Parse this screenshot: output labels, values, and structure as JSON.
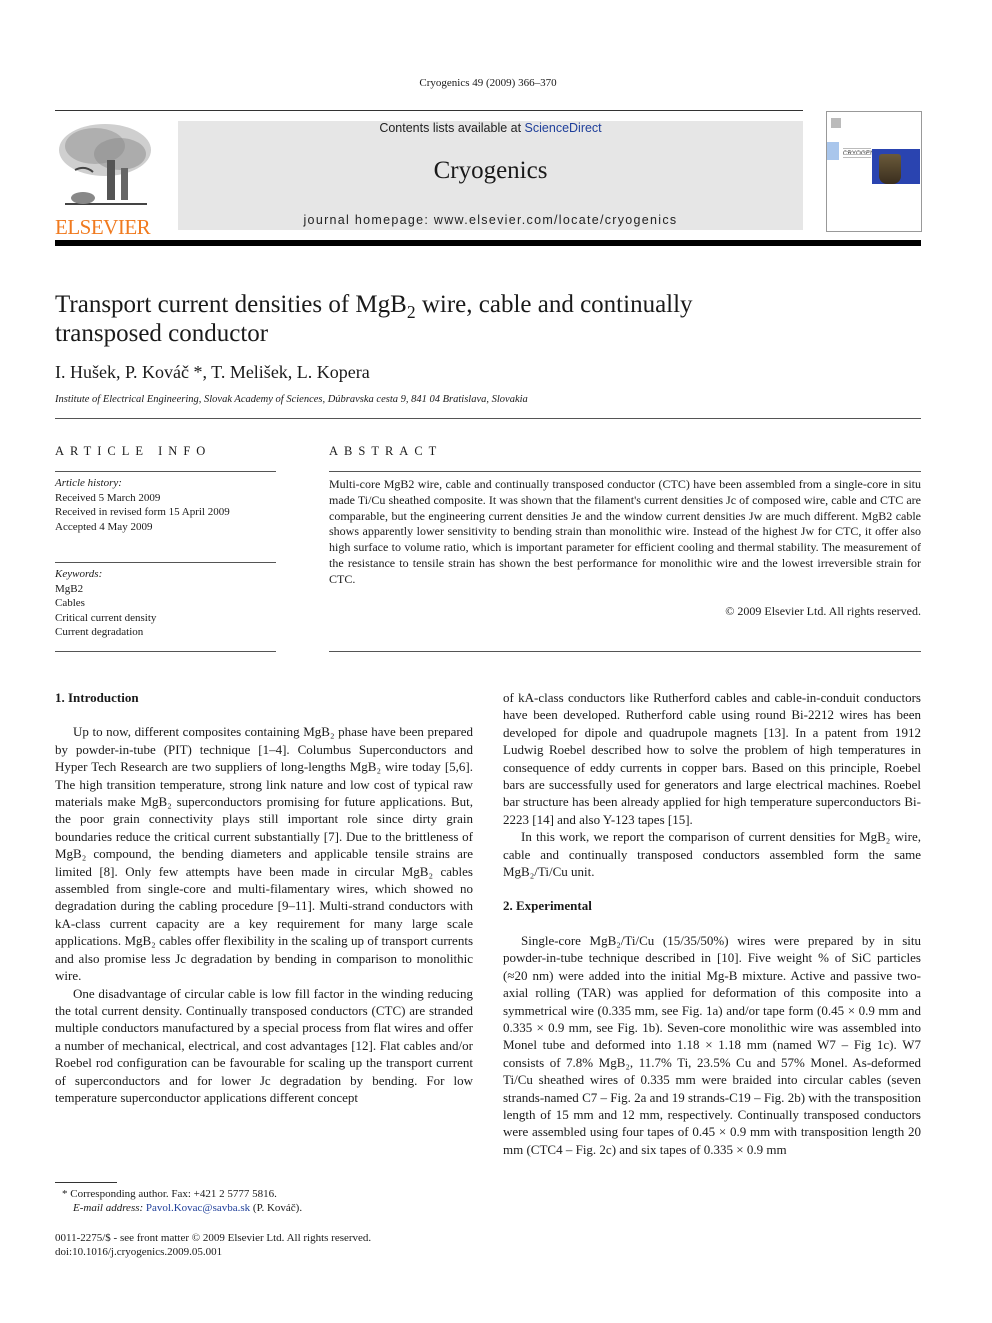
{
  "header": {
    "citation": "Cryogenics 49 (2009) 366–370",
    "contents_prefix": "Contents lists available at ",
    "contents_link": "ScienceDirect",
    "journal_name": "Cryogenics",
    "homepage": "journal homepage: www.elsevier.com/locate/cryogenics",
    "publisher_logo": "ELSEVIER",
    "cover_title": "CRYOGENICS",
    "colors": {
      "elsevier_orange": "#f07a1f",
      "link_blue": "#1f3f9a",
      "banner_gray": "#e6e6e6"
    }
  },
  "article": {
    "title_part1": "Transport current densities of MgB",
    "title_sub": "2",
    "title_part2": " wire, cable and continually transposed conductor",
    "authors": "I. Hušek, P. Kováč *, T. Melišek, L. Kopera",
    "affiliation": "Institute of Electrical Engineering, Slovak Academy of Sciences, Dúbravska cesta 9, 841 04 Bratislava, Slovakia"
  },
  "article_info": {
    "heading": "ARTICLE INFO",
    "history_label": "Article history:",
    "history": [
      "Received 5 March 2009",
      "Received in revised form 15 April 2009",
      "Accepted 4 May 2009"
    ],
    "keywords_label": "Keywords:",
    "keywords": [
      "MgB2",
      "Cables",
      "Critical current density",
      "Current degradation"
    ]
  },
  "abstract": {
    "heading": "ABSTRACT",
    "text": "Multi-core MgB2 wire, cable and continually transposed conductor (CTC) have been assembled from a single-core in situ made Ti/Cu sheathed composite. It was shown that the filament's current densities Jc of composed wire, cable and CTC are comparable, but the engineering current densities Je and the window current densities Jw are much different. MgB2 cable shows apparently lower sensitivity to bending strain than monolithic wire. Instead of the highest Jw for CTC, it offer also high surface to volume ratio, which is important parameter for efficient cooling and thermal stability. The measurement of the resistance to tensile strain has shown the best performance for monolithic wire and the lowest irreversible strain for CTC.",
    "copyright": "© 2009 Elsevier Ltd. All rights reserved."
  },
  "sections": {
    "intro_heading": "1. Introduction",
    "intro_p1": "Up to now, different composites containing MgB₂ phase have been prepared by powder-in-tube (PIT) technique [1–4]. Columbus Superconductors and Hyper Tech Research are two suppliers of long-lengths MgB₂ wire today [5,6]. The high transition temperature, strong link nature and low cost of typical raw materials make MgB₂ superconductors promising for future applications. But, the poor grain connectivity plays still important role since dirty grain boundaries reduce the critical current substantially [7]. Due to the brittleness of MgB₂ compound, the bending diameters and applicable tensile strains are limited [8]. Only few attempts have been made in circular MgB₂ cables assembled from single-core and multi-filamentary wires, which showed no degradation during the cabling procedure [9–11]. Multi-strand conductors with kA-class current capacity are a key requirement for many large scale applications. MgB₂ cables offer flexibility in the scaling up of transport currents and also promise less Jc degradation by bending in comparison to monolithic wire.",
    "intro_p2": "One disadvantage of circular cable is low fill factor in the winding reducing the total current density. Continually transposed conductors (CTC) are stranded multiple conductors manufactured by a special process from flat wires and offer a number of mechanical, electrical, and cost advantages [12]. Flat cables and/or Roebel rod configuration can be favourable for scaling up the transport current of superconductors and for lower Jc degradation by bending. For low temperature superconductor applications different concept of kA-class conductors like Rutherford cables and cable-in-conduit conductors have been developed. Rutherford cable using round Bi-2212 wires has been developed for dipole and quadrupole magnets [13]. In a patent from 1912 Ludwig Roebel described how to solve the problem of high temperatures in consequence of eddy currents in copper bars. Based on this principle, Roebel bars are successfully used for generators and large electrical machines. Roebel bar structure has been already applied for high temperature superconductors Bi-2223 [14] and also Y-123 tapes [15].",
    "intro_p3": "In this work, we report the comparison of current densities for MgB₂ wire, cable and continually transposed conductors assembled form the same MgB₂/Ti/Cu unit.",
    "exp_heading": "2. Experimental",
    "exp_p1": "Single-core MgB₂/Ti/Cu (15/35/50%) wires were prepared by in situ powder-in-tube technique described in [10]. Five weight % of SiC particles (≈20 nm) were added into the initial Mg-B mixture. Active and passive two-axial rolling (TAR) was applied for deformation of this composite into a symmetrical wire (0.335 mm, see Fig. 1a) and/or tape form (0.45 × 0.9 mm and 0.335 × 0.9 mm, see Fig. 1b). Seven-core monolithic wire was assembled into Monel tube and deformed into 1.18 × 1.18 mm (named W7 – Fig 1c). W7 consists of 7.8% MgB₂, 11.7% Ti, 23.5% Cu and 57% Monel. As-deformed Ti/Cu sheathed wires of 0.335 mm were braided into circular cables (seven strands-named C7 – Fig. 2a and 19 strands-C19 – Fig. 2b) with the transposition length of 15 mm and 12 mm, respectively. Continually transposed conductors were assembled using four tapes of 0.45 × 0.9 mm with transposition length 20 mm (CTC4 – Fig. 2c) and six tapes of 0.335 × 0.9 mm"
  },
  "footnotes": {
    "corresponding": "* Corresponding author. Fax: +421 2 5777 5816.",
    "email_label": "E-mail address: ",
    "email": "Pavol.Kovac@savba.sk",
    "email_suffix": " (P. Kováč).",
    "front_matter": "0011-2275/$ - see front matter © 2009 Elsevier Ltd. All rights reserved.",
    "doi": "doi:10.1016/j.cryogenics.2009.05.001"
  }
}
